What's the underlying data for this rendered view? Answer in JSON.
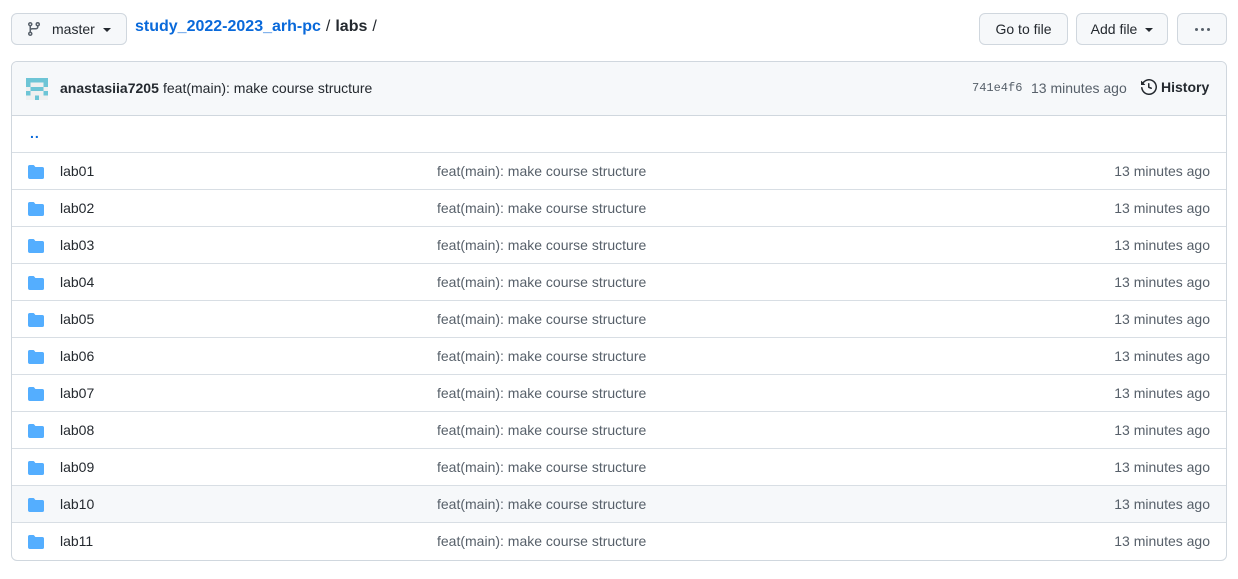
{
  "branch": {
    "label": "master"
  },
  "breadcrumb": {
    "repo": "study_2022-2023_arh-pc",
    "sep1": "/",
    "dir": "labs",
    "sep2": "/"
  },
  "actions": {
    "goto_file": "Go to file",
    "add_file": "Add file"
  },
  "commit": {
    "author": "anastasiia7205",
    "message": "feat(main): make course structure",
    "sha": "741e4f6",
    "time": "13 minutes ago",
    "history_label": "History"
  },
  "up_link": "..",
  "files": [
    {
      "name": "lab01",
      "message": "feat(main): make course structure",
      "time": "13 minutes ago"
    },
    {
      "name": "lab02",
      "message": "feat(main): make course structure",
      "time": "13 minutes ago"
    },
    {
      "name": "lab03",
      "message": "feat(main): make course structure",
      "time": "13 minutes ago"
    },
    {
      "name": "lab04",
      "message": "feat(main): make course structure",
      "time": "13 minutes ago"
    },
    {
      "name": "lab05",
      "message": "feat(main): make course structure",
      "time": "13 minutes ago"
    },
    {
      "name": "lab06",
      "message": "feat(main): make course structure",
      "time": "13 minutes ago"
    },
    {
      "name": "lab07",
      "message": "feat(main): make course structure",
      "time": "13 minutes ago"
    },
    {
      "name": "lab08",
      "message": "feat(main): make course structure",
      "time": "13 minutes ago"
    },
    {
      "name": "lab09",
      "message": "feat(main): make course structure",
      "time": "13 minutes ago"
    },
    {
      "name": "lab10",
      "message": "feat(main): make course structure",
      "time": "13 minutes ago"
    },
    {
      "name": "lab11",
      "message": "feat(main): make course structure",
      "time": "13 minutes ago"
    }
  ],
  "colors": {
    "link": "#0969da",
    "folder": "#54aeff",
    "muted": "#57606a",
    "hover_row": "#f6f8fa"
  },
  "icons": {
    "branch": "git-branch-icon",
    "folder": "folder-icon",
    "history": "history-icon",
    "more": "kebab-horizontal-icon"
  }
}
